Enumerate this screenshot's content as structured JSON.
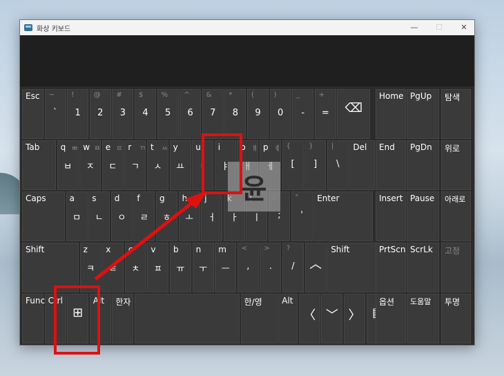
{
  "window": {
    "title": "화상 키보드",
    "buttons": {
      "minimize": "—",
      "maximize": "☐",
      "close": "✕"
    }
  },
  "rows": {
    "r1": [
      {
        "top": "Esc"
      },
      {
        "shift": "~",
        "main": "`"
      },
      {
        "shift": "!",
        "main": "1"
      },
      {
        "shift": "@",
        "main": "2"
      },
      {
        "shift": "#",
        "main": "3"
      },
      {
        "shift": "$",
        "main": "4"
      },
      {
        "shift": "%",
        "main": "5"
      },
      {
        "shift": "^",
        "main": "6"
      },
      {
        "shift": "&",
        "main": "7"
      },
      {
        "shift": "*",
        "main": "8"
      },
      {
        "shift": "(",
        "main": "9"
      },
      {
        "shift": ")",
        "main": "0"
      },
      {
        "shift": "_",
        "main": "-"
      },
      {
        "shift": "+",
        "main": "="
      },
      {
        "icon": "⌫"
      }
    ],
    "r2": [
      {
        "top": "Tab"
      },
      {
        "top": "q",
        "shift": "ㅃ",
        "main": "ㅂ"
      },
      {
        "top": "w",
        "shift": "ㅉ",
        "main": "ㅈ"
      },
      {
        "top": "e",
        "shift": "ㄸ",
        "main": "ㄷ"
      },
      {
        "top": "r",
        "shift": "ㄲ",
        "main": "ㄱ"
      },
      {
        "top": "t",
        "shift": "ㅆ",
        "main": "ㅅ"
      },
      {
        "top": "y",
        "main": "ㅛ"
      },
      {
        "top": "u",
        "main": "ㅕ"
      },
      {
        "top": "i",
        "main": "ㅑ"
      },
      {
        "top": "o",
        "shift": "ㅒ",
        "main": "ㅐ"
      },
      {
        "top": "p",
        "shift": "ㅖ",
        "main": "ㅔ"
      },
      {
        "shift": "{",
        "main": "["
      },
      {
        "shift": "}",
        "main": "]"
      },
      {
        "shift": "|",
        "main": "\\"
      },
      {
        "top": "Del"
      }
    ],
    "r3": [
      {
        "top": "Caps"
      },
      {
        "top": "a",
        "main": "ㅁ"
      },
      {
        "top": "s",
        "main": "ㄴ"
      },
      {
        "top": "d",
        "main": "ㅇ"
      },
      {
        "top": "f",
        "main": "ㄹ"
      },
      {
        "top": "g",
        "main": "ㅎ"
      },
      {
        "top": "h",
        "main": "ㅗ"
      },
      {
        "top": "j",
        "main": "ㅓ"
      },
      {
        "top": "k",
        "main": "ㅏ"
      },
      {
        "top": "l",
        "main": "ㅣ"
      },
      {
        "shift": ":",
        "main": ";"
      },
      {
        "shift": "\"",
        "main": "'"
      },
      {
        "top": "Enter"
      }
    ],
    "r4": [
      {
        "top": "Shift"
      },
      {
        "top": "z",
        "main": "ㅋ"
      },
      {
        "top": "x",
        "main": "ㅌ"
      },
      {
        "top": "c",
        "main": "ㅊ"
      },
      {
        "top": "v",
        "main": "ㅍ"
      },
      {
        "top": "b",
        "main": "ㅠ"
      },
      {
        "top": "n",
        "main": "ㅜ"
      },
      {
        "top": "m",
        "main": "ㅡ"
      },
      {
        "shift": "<",
        "main": ","
      },
      {
        "shift": ">",
        "main": "."
      },
      {
        "shift": "?",
        "main": "/"
      },
      {
        "icon": "︿"
      },
      {
        "top": "Shift"
      }
    ],
    "r5": [
      {
        "top": "Func"
      },
      {
        "top": "Ctrl"
      },
      {
        "icon": "⊞"
      },
      {
        "top": "Alt"
      },
      {
        "top": "한자"
      },
      {
        "top": ""
      },
      {
        "top": "한/영"
      },
      {
        "top": "Alt"
      },
      {
        "icon": "〈"
      },
      {
        "icon": "﹀"
      },
      {
        "icon": "〉"
      },
      {
        "icon": "▤"
      }
    ]
  },
  "nav": [
    {
      "top": "Home"
    },
    {
      "top": "PgUp"
    },
    {
      "top": "탐색"
    },
    {
      "top": "End"
    },
    {
      "top": "PgDn"
    },
    {
      "top": "위로"
    },
    {
      "top": "Insert"
    },
    {
      "top": "Pause"
    },
    {
      "top": "아래로"
    },
    {
      "top": "PrtScn"
    },
    {
      "top": "ScrLk"
    },
    {
      "top": "고정"
    },
    {
      "top": "옵션"
    },
    {
      "top": "도움말"
    },
    {
      "top": "투명"
    }
  ],
  "watermark": "윤",
  "colors": {
    "annotation": "#e01010",
    "key_bg": "#3a3a3a",
    "window_bg": "#2b2b2b"
  }
}
